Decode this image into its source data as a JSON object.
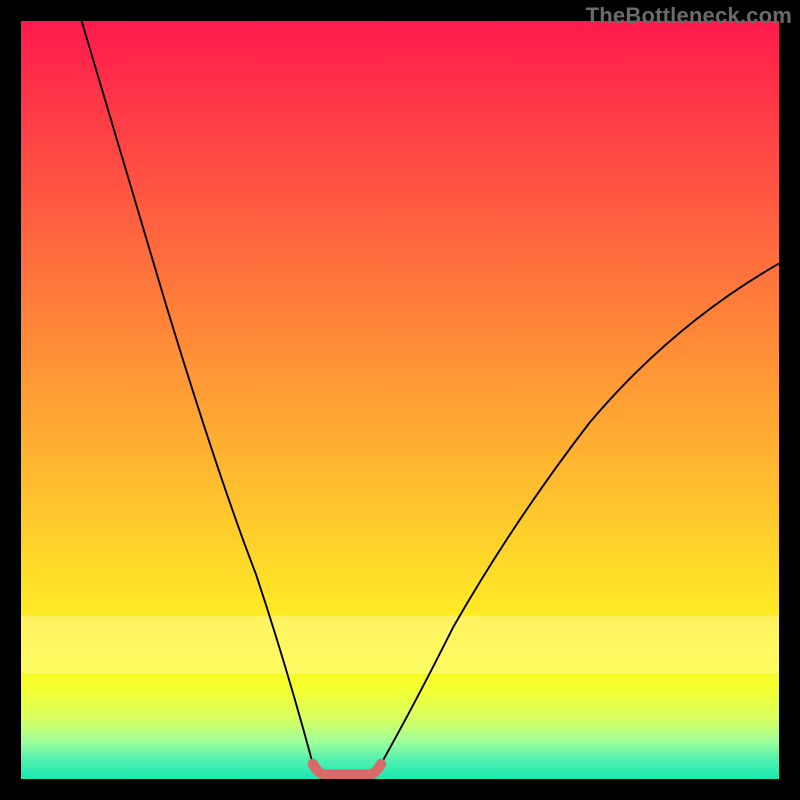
{
  "watermark": "TheBottleneck.com",
  "colors": {
    "background": "#000000",
    "curve": "#000000",
    "highlight": "#d86a6a",
    "gradient_top": "#ff1a4d",
    "gradient_bottom": "#18e8b0"
  },
  "chart_data": {
    "type": "line",
    "title": "",
    "xlabel": "",
    "ylabel": "",
    "xlim": [
      0,
      100
    ],
    "ylim": [
      0,
      100
    ],
    "grid": false,
    "legend": false,
    "annotations": [],
    "series": [
      {
        "name": "left-curve",
        "x": [
          8,
          10,
          13,
          16,
          19,
          22,
          25,
          28,
          31,
          34,
          36.5,
          38.5
        ],
        "y": [
          100,
          92,
          82,
          72,
          63,
          54,
          45,
          36,
          27,
          17,
          8,
          2
        ]
      },
      {
        "name": "right-curve",
        "x": [
          47.5,
          50,
          53,
          57,
          62,
          68,
          75,
          83,
          92,
          100
        ],
        "y": [
          2,
          6,
          12,
          20,
          29,
          38,
          47,
          55,
          62,
          68
        ]
      },
      {
        "name": "trough-highlight",
        "x": [
          38.5,
          39.5,
          41,
          43,
          45,
          46.5,
          47.5
        ],
        "y": [
          2,
          0.8,
          0.5,
          0.5,
          0.5,
          0.8,
          2
        ]
      }
    ]
  }
}
